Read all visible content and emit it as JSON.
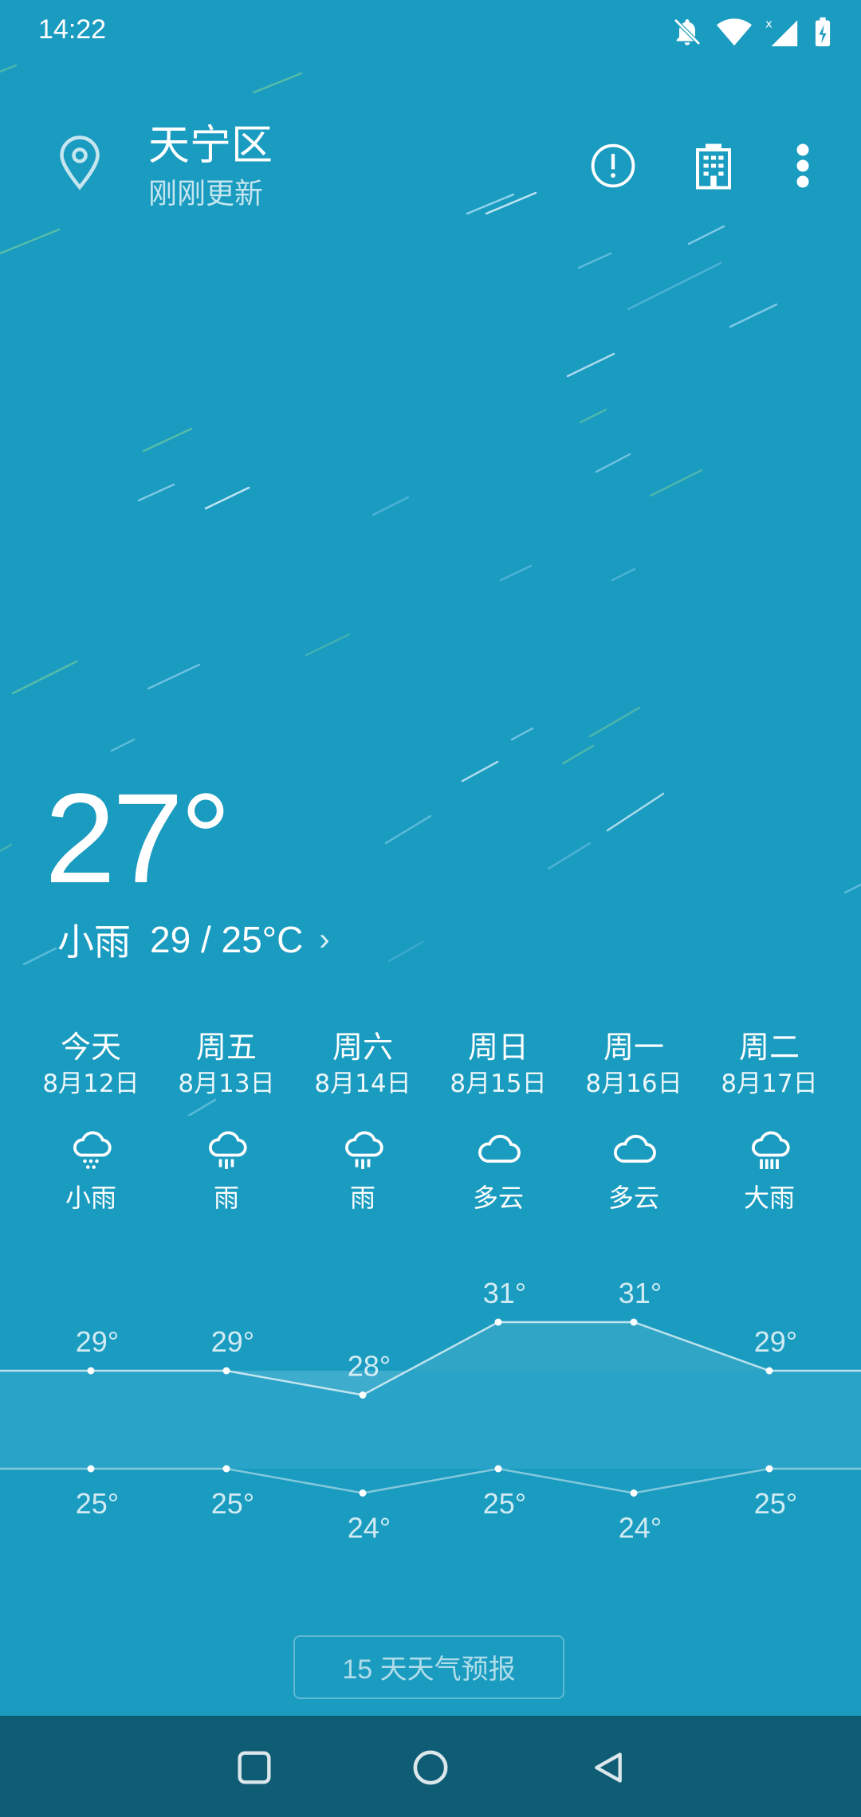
{
  "status_bar": {
    "time": "14:22"
  },
  "header": {
    "location": "天宁区",
    "updated": "刚刚更新"
  },
  "current": {
    "temperature": "27°",
    "condition": "小雨",
    "range": "29 / 25°C",
    "chevron": "›"
  },
  "days": [
    {
      "name": "今天",
      "date": "8月12日",
      "icon": "light-rain-icon",
      "condition": "小雨"
    },
    {
      "name": "周五",
      "date": "8月13日",
      "icon": "rain-icon",
      "condition": "雨"
    },
    {
      "name": "周六",
      "date": "8月14日",
      "icon": "rain-icon",
      "condition": "雨"
    },
    {
      "name": "周日",
      "date": "8月15日",
      "icon": "cloud-icon",
      "condition": "多云"
    },
    {
      "name": "周一",
      "date": "8月16日",
      "icon": "cloud-icon",
      "condition": "多云"
    },
    {
      "name": "周二",
      "date": "8月17日",
      "icon": "heavy-rain-icon",
      "condition": "大雨"
    }
  ],
  "chart_data": {
    "type": "line",
    "categories": [
      "今天",
      "周五",
      "周六",
      "周日",
      "周一",
      "周二"
    ],
    "series": [
      {
        "values": [
          29,
          29,
          28,
          31,
          31,
          29
        ],
        "labels": [
          "29°",
          "29°",
          "28°",
          "31°",
          "31°",
          "29°"
        ]
      },
      {
        "values": [
          25,
          25,
          24,
          25,
          24,
          25
        ],
        "labels": [
          "25°",
          "25°",
          "24°",
          "25°",
          "24°",
          "25°"
        ]
      }
    ]
  },
  "forecast_button": "15 天天气预报",
  "colors": {
    "background": "#1a9bc0",
    "navbar": "#0e5d75",
    "band": "#34a8cb"
  }
}
